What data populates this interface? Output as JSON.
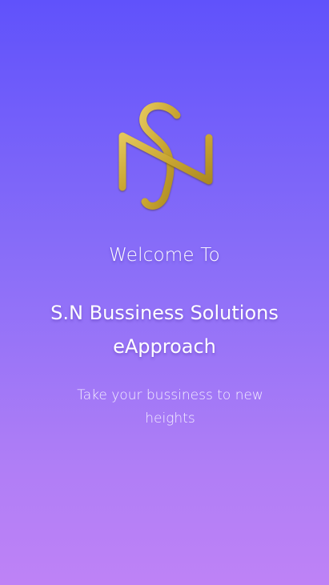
{
  "splash": {
    "welcome": "Welcome To",
    "company_line1": "S.N Bussiness Solutions",
    "company_line2": "eApproach",
    "tagline": "Take your bussiness to new heights"
  },
  "logo": {
    "icon": "sn-monogram-logo",
    "color": "#c9a632"
  },
  "colors": {
    "gradient_top": "#6052fb",
    "gradient_bottom": "#be82f6",
    "text": "#ffffff"
  }
}
